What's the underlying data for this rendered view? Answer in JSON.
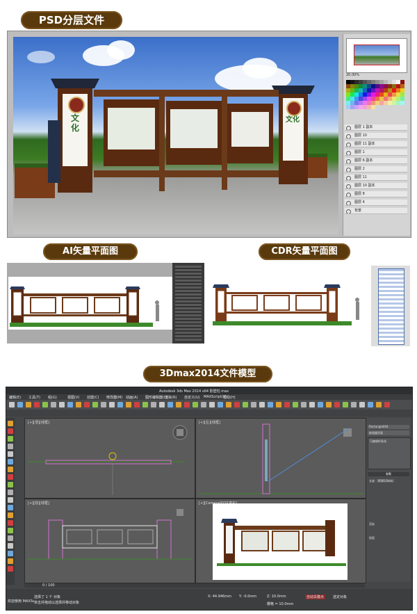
{
  "sections": {
    "psd_label": "PSD分层文件",
    "ai_label": "AI矢量平面图",
    "cdr_label": "CDR矢量平面图",
    "max_label": "3Dmax2014文件模型"
  },
  "artwork": {
    "sign_text": "文化"
  },
  "photoshop": {
    "zoom": "20.00%",
    "layer_names": [
      "图层 1 副本",
      "图层 10",
      "图层 11 副本",
      "图层 1",
      "图层 6 副本",
      "图层 2",
      "图层 11",
      "图层 10 副本",
      "图层 8",
      "图层 4",
      "背景"
    ]
  },
  "max3d": {
    "window_title": "Autodesk 3ds Max 2014 x64   影壁柱.max",
    "menus": [
      "编辑(E)",
      "工具(T)",
      "组(G)",
      "视图(V)",
      "创建(C)",
      "修改器(M)",
      "动画(A)",
      "图形编辑器(D)",
      "渲染(R)",
      "自定义(U)",
      "MAXScript(X)",
      "帮助(H)"
    ],
    "viewport_labels": [
      "[+][顶][线框]",
      "[+][左][线框]",
      "[+][前][线框]",
      "[+][Camera003][真实]"
    ],
    "modifier_list_label": "修改器列表",
    "object_name": "Rectangle004",
    "stack_item": "可编辑样条线",
    "rollout_title": "参数",
    "length_label": "长度:",
    "length_value": "0000.0mm",
    "rollout_item1": "渲染",
    "rollout_item2": "插值",
    "timeline": "0 / 100",
    "status_left": "选择了 1 个 对象",
    "status_hint": "单击并拖动以选择并移动对象",
    "coord_x": "X: 44.946mm",
    "coord_y": "Y: -0.0mm",
    "coord_z": "Z: 10.0mm",
    "grid": "栅格 = 10.0mm",
    "autokey": "自动关键点",
    "selected": "选定对象",
    "welcome": "欢迎使用 MAXSc"
  },
  "colors": {
    "label_bg": "#5a3a0d",
    "wood": "#6b3a1a",
    "max_bg": "#444648"
  }
}
